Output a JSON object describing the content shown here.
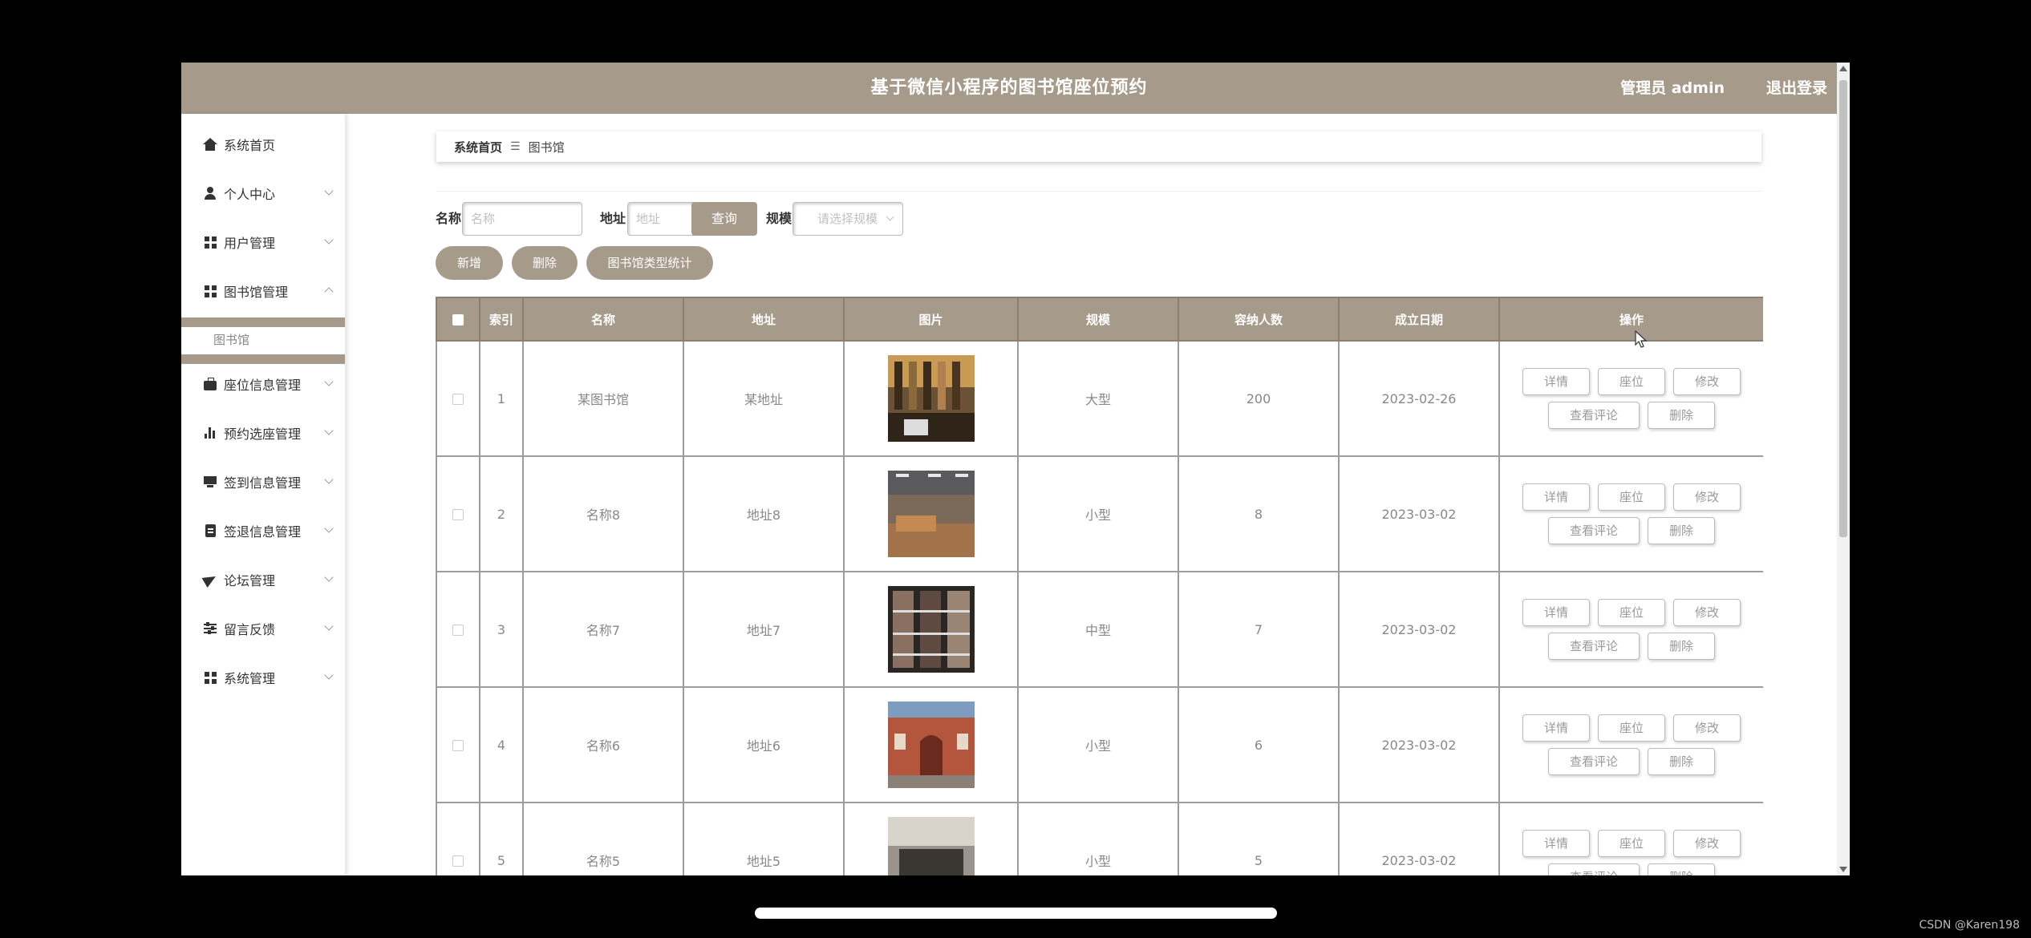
{
  "header": {
    "title": "基于微信小程序的图书馆座位预约",
    "user": "管理员 admin",
    "logout": "退出登录"
  },
  "sidebar": {
    "items": [
      {
        "label": "系统首页",
        "icon": "home-icon"
      },
      {
        "label": "个人中心",
        "icon": "user-icon"
      },
      {
        "label": "用户管理",
        "icon": "grid-icon"
      },
      {
        "label": "图书馆管理",
        "icon": "grid-icon"
      },
      {
        "label": "座位信息管理",
        "icon": "briefcase-icon"
      },
      {
        "label": "预约选座管理",
        "icon": "bar-chart-icon"
      },
      {
        "label": "签到信息管理",
        "icon": "monitor-icon"
      },
      {
        "label": "签退信息管理",
        "icon": "clipboard-icon"
      },
      {
        "label": "论坛管理",
        "icon": "paper-plane-icon"
      },
      {
        "label": "留言反馈",
        "icon": "sliders-icon"
      },
      {
        "label": "系统管理",
        "icon": "grid-icon"
      }
    ],
    "submenu": {
      "label": "图书馆"
    }
  },
  "breadcrumb": {
    "home": "系统首页",
    "separator": "☰",
    "current": "图书馆"
  },
  "search": {
    "name_label": "名称",
    "name_placeholder": "名称",
    "address_label": "地址",
    "address_placeholder": "地址",
    "scale_label": "规模",
    "scale_placeholder": "请选择规模",
    "query_button": "查询"
  },
  "actions": {
    "add": "新增",
    "delete": "删除",
    "stats": "图书馆类型统计"
  },
  "table": {
    "columns": [
      "索引",
      "名称",
      "地址",
      "图片",
      "规模",
      "容纳人数",
      "成立日期",
      "操作"
    ],
    "rows": [
      {
        "index": "1",
        "name": "某图书馆",
        "address": "某地址",
        "scale": "大型",
        "capacity": "200",
        "date": "2023-02-26"
      },
      {
        "index": "2",
        "name": "名称8",
        "address": "地址8",
        "scale": "小型",
        "capacity": "8",
        "date": "2023-03-02"
      },
      {
        "index": "3",
        "name": "名称7",
        "address": "地址7",
        "scale": "中型",
        "capacity": "7",
        "date": "2023-03-02"
      },
      {
        "index": "4",
        "name": "名称6",
        "address": "地址6",
        "scale": "小型",
        "capacity": "6",
        "date": "2023-03-02"
      },
      {
        "index": "5",
        "name": "名称5",
        "address": "地址5",
        "scale": "小型",
        "capacity": "5",
        "date": "2023-03-02"
      }
    ],
    "ops": {
      "detail": "详情",
      "seat": "座位",
      "edit": "修改",
      "comments": "查看评论",
      "delete": "删除"
    }
  },
  "watermark": "CSDN @Karen198",
  "colors": {
    "accent": "#a69a8b",
    "background": "#ffffff",
    "frame": "#000000"
  }
}
